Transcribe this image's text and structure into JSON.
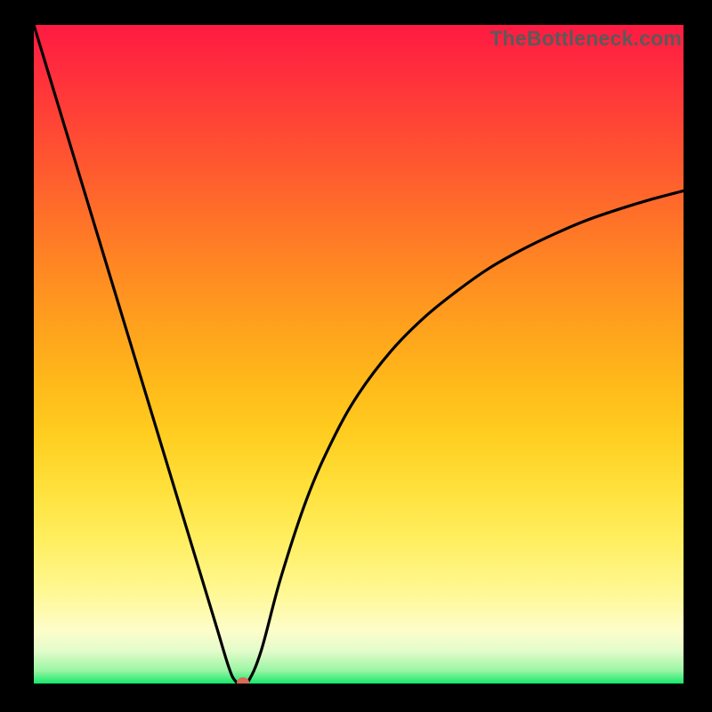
{
  "watermark": "TheBottleneck.com",
  "colors": {
    "frame": "#000000",
    "curve": "#000000",
    "marker": "#d86a58",
    "gradient_top": "#ff1a42",
    "gradient_bottom": "#17e86b"
  },
  "chart_data": {
    "type": "line",
    "title": "",
    "xlabel": "",
    "ylabel": "",
    "xlim": [
      0,
      100
    ],
    "ylim": [
      0,
      100
    ],
    "grid": false,
    "legend": false,
    "series": [
      {
        "name": "bottleneck-curve",
        "x": [
          0,
          4,
          8,
          12,
          16,
          20,
          24,
          28,
          30,
          31,
          32,
          33,
          35,
          38,
          42,
          46,
          50,
          55,
          60,
          65,
          70,
          75,
          80,
          85,
          90,
          95,
          100
        ],
        "values": [
          100,
          87,
          74,
          61,
          48,
          35,
          22,
          9,
          2.5,
          0.4,
          0,
          0.3,
          5,
          16,
          28,
          37,
          44,
          50.5,
          55.5,
          59.5,
          63,
          65.8,
          68.2,
          70.3,
          72,
          73.5,
          74.8
        ]
      }
    ],
    "marker": {
      "x": 32.2,
      "y": 0.2
    },
    "background": "vertical-gradient-red-to-green"
  }
}
